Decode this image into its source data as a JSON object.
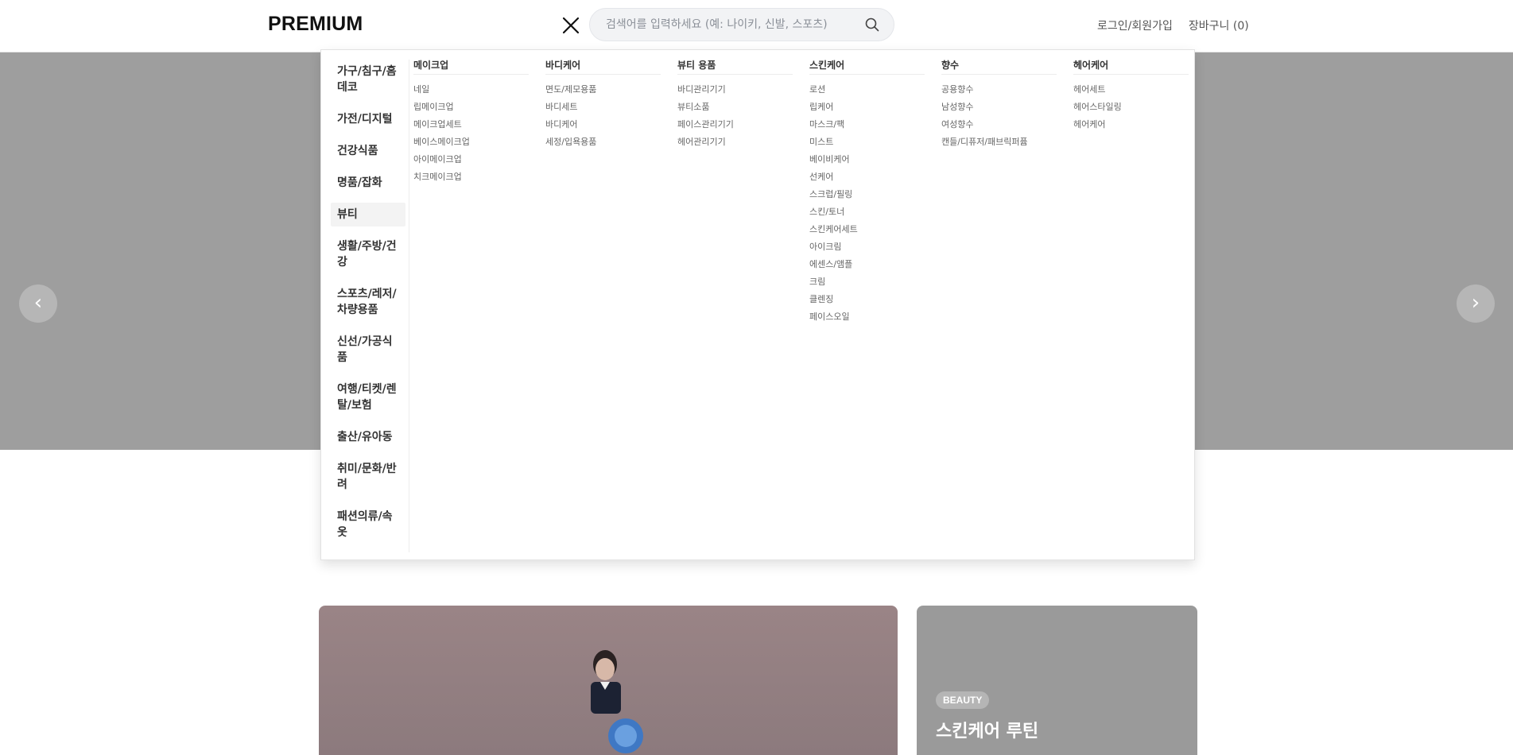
{
  "header": {
    "logo": "PREMIUM",
    "search_placeholder": "검색어를 입력하세요 (예: 나이키, 신발, 스포츠)",
    "login_label": "로그인/회원가입",
    "cart_label": "장바구니 (0)"
  },
  "hero": {
    "prev_label": "‹",
    "next_label": "›",
    "background_color": "#9e9e9e"
  },
  "mega_menu": {
    "categories": [
      {
        "label": "가구/침구/홈데코"
      },
      {
        "label": "가전/디지털"
      },
      {
        "label": "건강식품"
      },
      {
        "label": "명품/잡화"
      },
      {
        "label": "뷰티",
        "active": true
      },
      {
        "label": "생활/주방/건강"
      },
      {
        "label": "스포츠/레저/차량용품"
      },
      {
        "label": "신선/가공식품"
      },
      {
        "label": "여행/티켓/렌탈/보험"
      },
      {
        "label": "출산/유아동"
      },
      {
        "label": "취미/문화/반려"
      },
      {
        "label": "패션의류/속옷"
      }
    ],
    "subcategories": [
      {
        "title": "메이크업",
        "items": [
          "네일",
          "립메이크업",
          "메이크업세트",
          "베이스메이크업",
          "아이메이크업",
          "치크메이크업"
        ]
      },
      {
        "title": "바디케어",
        "items": [
          "면도/제모용품",
          "바디세트",
          "바디케어",
          "세정/입욕용품"
        ]
      },
      {
        "title": "뷰티 용품",
        "items": [
          "바디관리기기",
          "뷰티소품",
          "페이스관리기기",
          "헤어관리기기"
        ]
      },
      {
        "title": "스킨케어",
        "items": [
          "로션",
          "립케어",
          "마스크/팩",
          "미스트",
          "베이비케어",
          "선케어",
          "스크럽/필링",
          "스킨/토너",
          "스킨케어세트",
          "아이크림",
          "에센스/앰플",
          "크림",
          "클렌징",
          "페이스오일"
        ]
      },
      {
        "title": "향수",
        "items": [
          "공용향수",
          "남성향수",
          "여성향수",
          "캔들/디퓨저/패브릭퍼퓸"
        ]
      },
      {
        "title": "헤어케어",
        "items": [
          "헤어세트",
          "헤어스타일링",
          "헤어케어"
        ]
      }
    ]
  },
  "cards": {
    "side_badge": "BEAUTY",
    "side_title": "스킨케어 루틴"
  }
}
